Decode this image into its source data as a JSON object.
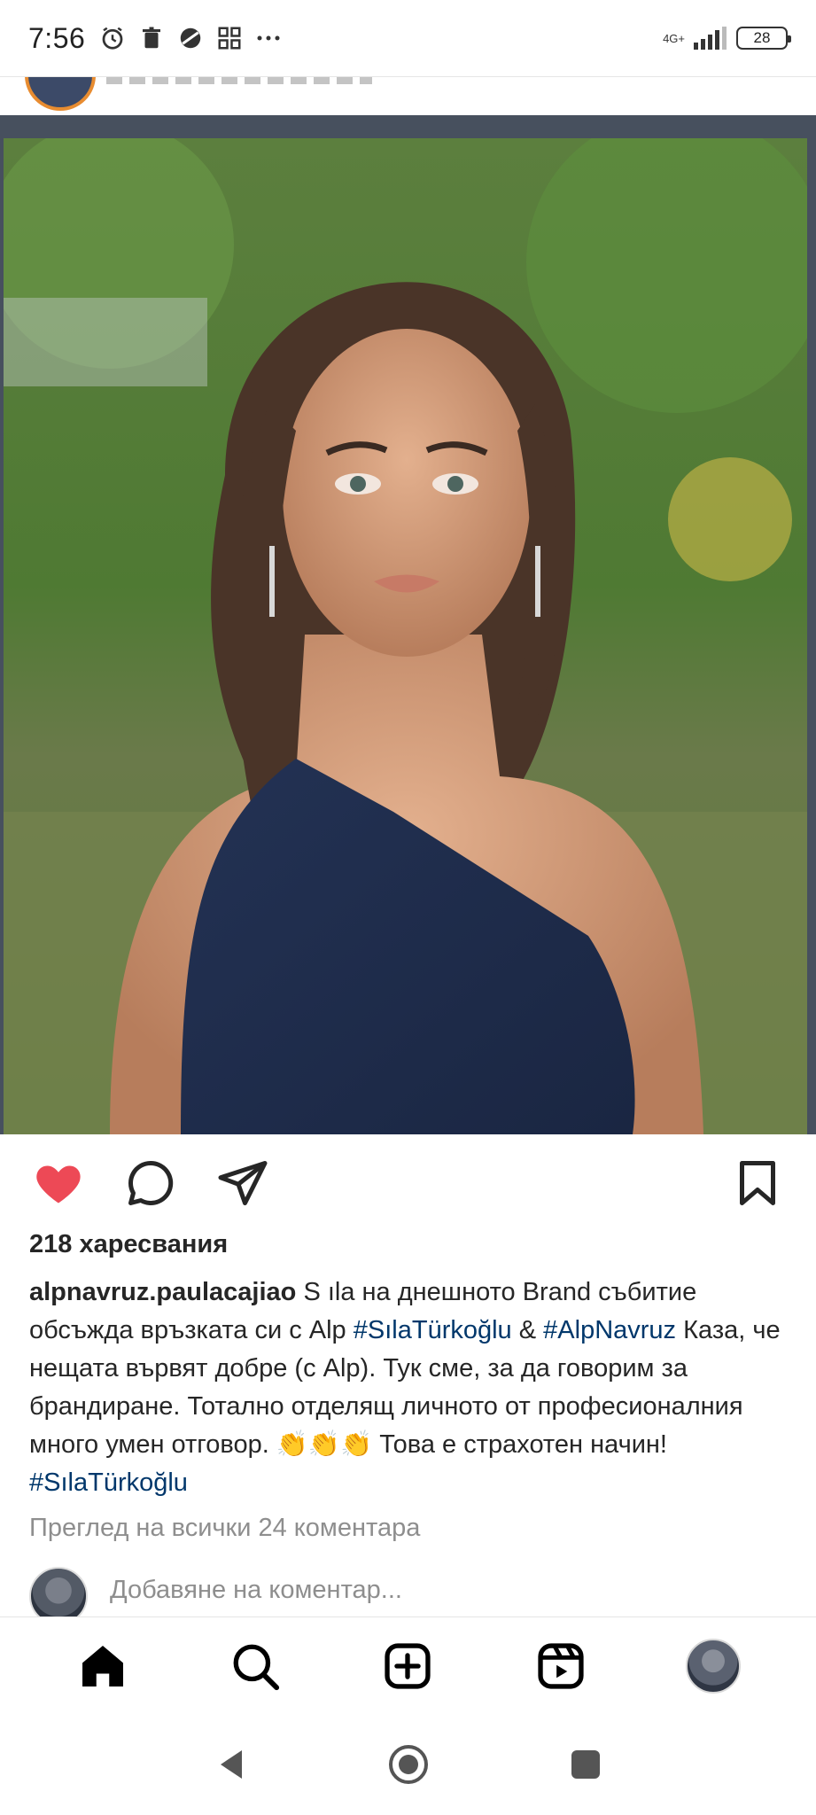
{
  "status_bar": {
    "time": "7:56",
    "network": "4G+",
    "battery": "28",
    "icons": [
      "alarm-icon",
      "trash-icon",
      "vpn-icon",
      "apps-icon",
      "more-dots-icon"
    ]
  },
  "post": {
    "image_alt": "",
    "liked": true,
    "likes_text": "218 харесвания",
    "caption": {
      "username": "alpnavruz.paulacajiao",
      "part1": " S ıla на днешното Brand събитие обсъжда връзката си с Alp ",
      "hashtag1": "#SılaTürkoğlu",
      "part2": " & ",
      "hashtag2": "#AlpNavruz",
      "part3": " Каза, че нещата вървят добре (с Alp). Тук сме, за да говорим за брандиране. Тотално отделящ личното от професионалния много умен отговор. 👏👏👏 Това е страхотен начин! ",
      "hashtag3": "#SılaTürkoğlu"
    },
    "view_comments": "Преглед на всички 24 коментара",
    "add_comment_placeholder": "Добавяне на коментар..."
  },
  "colors": {
    "like_red": "#ed4956",
    "hashtag_blue": "#00376b",
    "secondary_gray": "#8e8e8e"
  },
  "bottom_nav": {
    "items": [
      "home-icon",
      "search-icon",
      "create-post-icon",
      "reels-icon",
      "profile-avatar"
    ],
    "active": "home-icon"
  },
  "system_nav": [
    "back-icon",
    "home-circle-icon",
    "recents-icon"
  ]
}
